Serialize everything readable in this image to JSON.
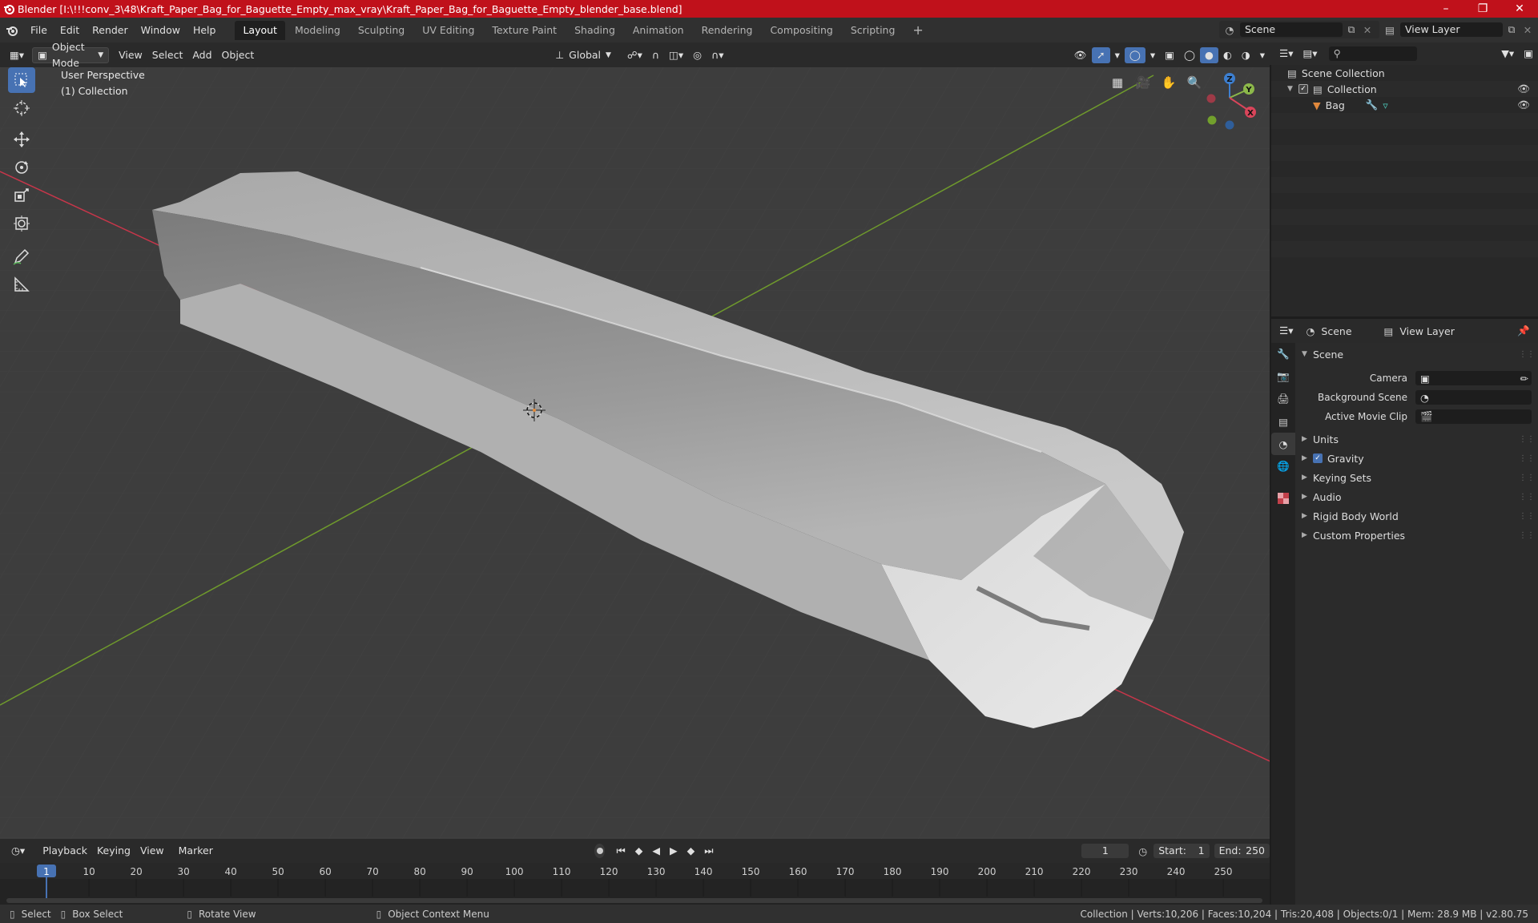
{
  "window": {
    "title": "Blender [I:\\!!!conv_3\\48\\Kraft_Paper_Bag_for_Baguette_Empty_max_vray\\Kraft_Paper_Bag_for_Baguette_Empty_blender_base.blend]",
    "minimize": "–",
    "maximize": "❐",
    "close": "✕"
  },
  "menu": [
    "File",
    "Edit",
    "Render",
    "Window",
    "Help"
  ],
  "workspaces": [
    "Layout",
    "Modeling",
    "Sculpting",
    "UV Editing",
    "Texture Paint",
    "Shading",
    "Animation",
    "Rendering",
    "Compositing",
    "Scripting"
  ],
  "active_workspace": "Layout",
  "scene_selector": "Scene",
  "view_layer_selector": "View Layer",
  "viewport_header": {
    "mode": "Object Mode",
    "menus": [
      "View",
      "Select",
      "Add",
      "Object"
    ],
    "orientation": "Global"
  },
  "viewport": {
    "perspective": "User Perspective",
    "collection": "(1) Collection",
    "gizmo": {
      "x": "X",
      "y": "Y",
      "z": "Z"
    }
  },
  "outliner": {
    "root": "Scene Collection",
    "collection": "Collection",
    "object": "Bag"
  },
  "properties": {
    "tab_scene": "Scene",
    "tab_view_layer": "View Layer",
    "panel_title": "Scene",
    "camera_label": "Camera",
    "bg_scene_label": "Background Scene",
    "movie_clip_label": "Active Movie Clip",
    "sections": [
      "Units",
      "Gravity",
      "Keying Sets",
      "Audio",
      "Rigid Body World",
      "Custom Properties"
    ]
  },
  "timeline": {
    "menus": [
      "Playback",
      "Keying",
      "View",
      "Marker"
    ],
    "current_frame": "1",
    "start_label": "Start:",
    "start": "1",
    "end_label": "End:",
    "end": "250",
    "ticks": [
      "1",
      "10",
      "20",
      "30",
      "40",
      "50",
      "60",
      "70",
      "80",
      "90",
      "100",
      "110",
      "120",
      "130",
      "140",
      "150",
      "160",
      "170",
      "180",
      "190",
      "200",
      "210",
      "220",
      "230",
      "240",
      "250"
    ]
  },
  "statusbar": {
    "select": "Select",
    "box_select": "Box Select",
    "rotate": "Rotate View",
    "context": "Object Context Menu",
    "stats": "Collection | Verts:10,206 | Faces:10,204 | Tris:20,408 | Objects:0/1 | Mem: 28.9 MB | v2.80.75"
  },
  "colors": {
    "title_bar": "#c0111b",
    "accent": "#4772b3",
    "x_axis": "#c7364a",
    "y_axis": "#6f9a2c"
  }
}
